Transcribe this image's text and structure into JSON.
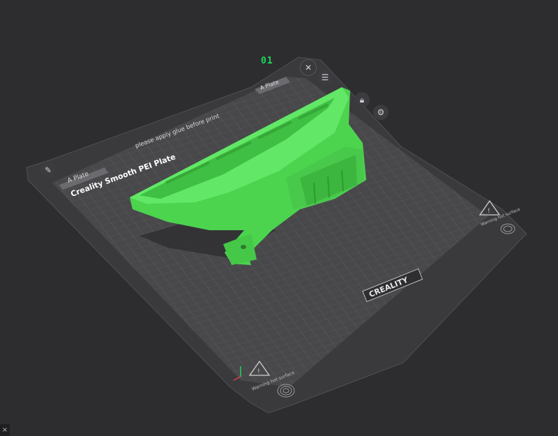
{
  "plate": {
    "number": "01",
    "tab_label_left": "A Plate",
    "tab_label_right": "A Plate",
    "glue_note": "please apply glue before print",
    "plate_title": "Creality Smooth PEI Plate",
    "brand": "CREALITY",
    "warning_text": "Warning hot surface"
  },
  "toolbar": {
    "close_icon": "close-icon",
    "arrange_icon": "list-icon",
    "lock_icon": "lock-icon",
    "settings_icon": "gear-icon",
    "edit_icon": "pencil-icon"
  },
  "model": {
    "color": "#59e35d"
  },
  "colors": {
    "background": "#2d2d30",
    "plate": "#4a4a4d",
    "grid": "#606064",
    "accent": "#1ed760"
  },
  "window": {
    "close_glyph": "×"
  }
}
